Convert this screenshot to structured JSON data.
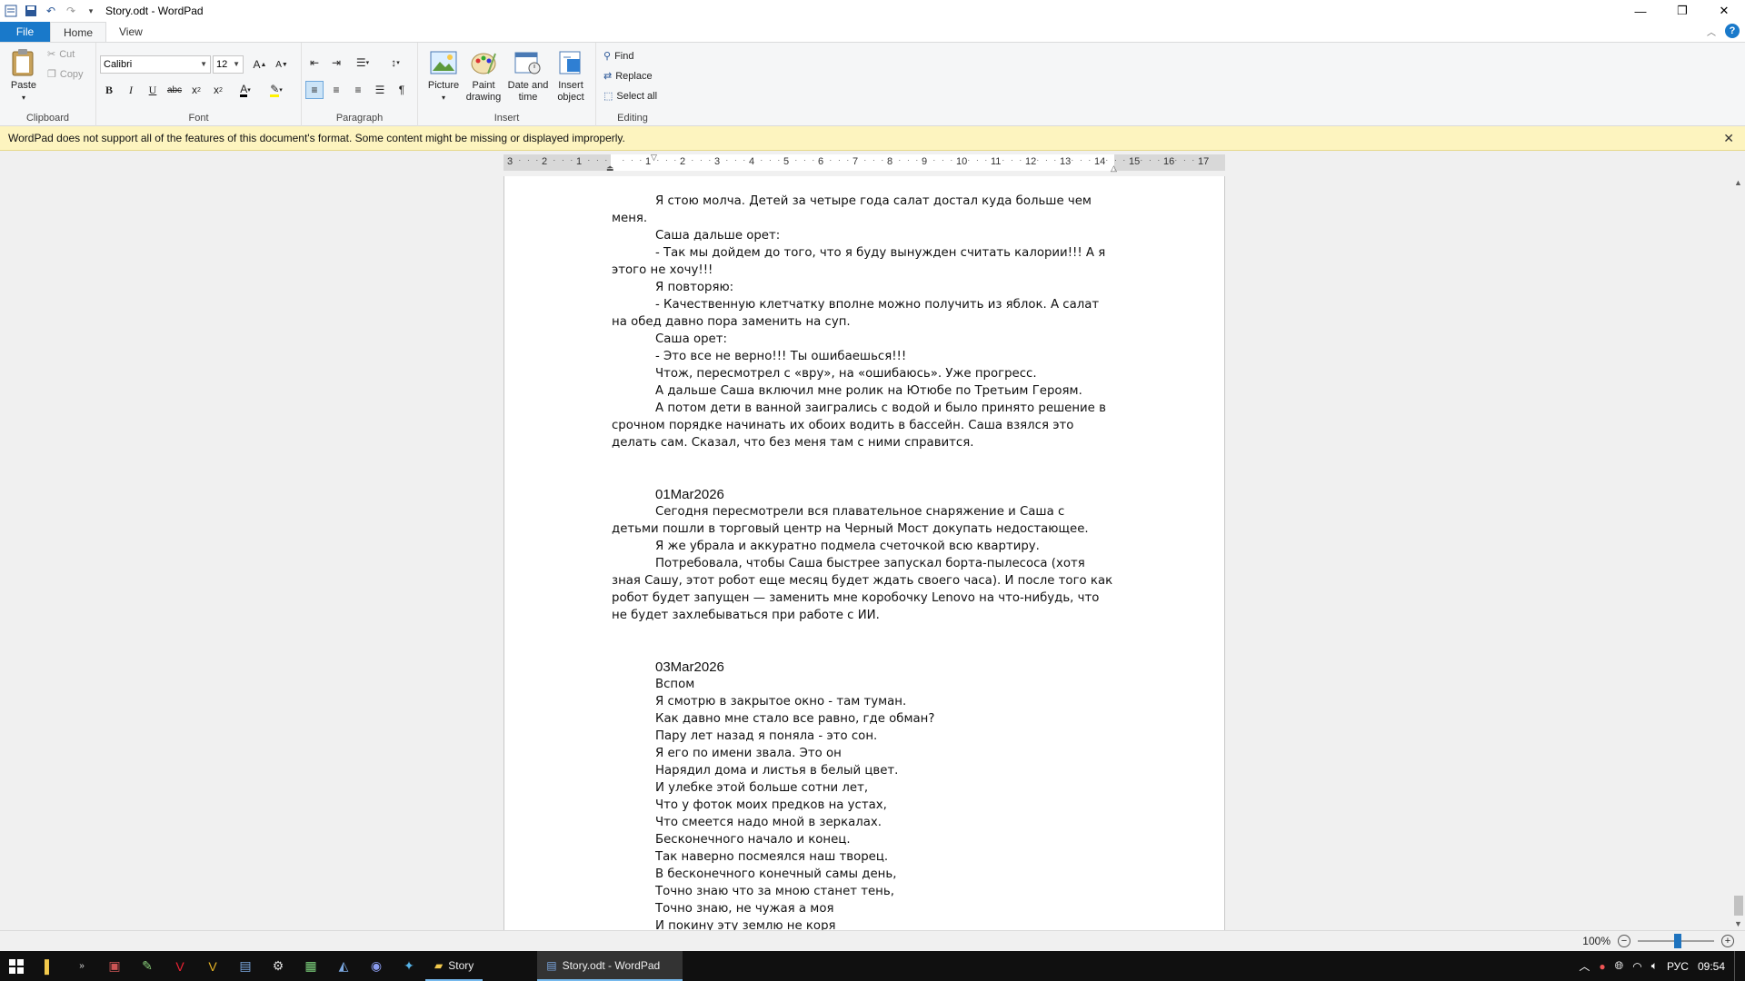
{
  "window": {
    "title": "Story.odt - WordPad",
    "controls": {
      "minimize": "—",
      "maximize": "❐",
      "close": "✕"
    }
  },
  "ribbon": {
    "tabs": [
      "File",
      "Home",
      "View"
    ],
    "clipboard": {
      "label": "Clipboard",
      "paste": "Paste",
      "cut": "Cut",
      "copy": "Copy"
    },
    "font": {
      "label": "Font",
      "family": "Calibri",
      "size": "12"
    },
    "paragraph": {
      "label": "Paragraph"
    },
    "insert": {
      "label": "Insert",
      "picture": "Picture",
      "paint_drawing": "Paint drawing",
      "date_time": "Date and time",
      "insert_object": "Insert object"
    },
    "editing": {
      "label": "Editing",
      "find": "Find",
      "replace": "Replace",
      "select_all": "Select all"
    }
  },
  "infobar": {
    "message": "WordPad does not support all of the features of this document's format. Some content might be missing or displayed improperly."
  },
  "ruler": {
    "numbers": [
      "3",
      "2",
      "1",
      "",
      "1",
      "2",
      "3",
      "4",
      "5",
      "6",
      "7",
      "8",
      "9",
      "10",
      "11",
      "12",
      "13",
      "14",
      "15",
      "16",
      "17"
    ]
  },
  "document": {
    "lines": [
      {
        "type": "ind",
        "text": "Я стою молча. Детей за четыре года салат достал куда больше чем меня."
      },
      {
        "type": "ind",
        "text": "Саша дальше орет:"
      },
      {
        "type": "ind",
        "text": "- Так мы дойдем до того, что я буду вынужден считать калории!!! А я этого не хочу!!!"
      },
      {
        "type": "ind",
        "text": "Я повторяю:"
      },
      {
        "type": "ind",
        "text": "- Качественную клетчатку вполне можно получить из яблок. А салат на обед давно пора  заменить на суп."
      },
      {
        "type": "ind",
        "text": "Саша орет:"
      },
      {
        "type": "ind",
        "text": "- Это все не верно!!! Ты ошибаешься!!!"
      },
      {
        "type": "ind",
        "text": "Чтож,  пересмотрел  с «вру», на «ошибаюсь». Уже прогресс."
      },
      {
        "type": "ind",
        "text": "А дальше Саша включил мне ролик на Ютюбе по Третьим Героям."
      },
      {
        "type": "ind",
        "text": "А потом дети в ванной заигрались с водой и было принято решение в срочном порядке начинать их обоих водить в бассейн. Саша взялся это делать сам. Сказал, что без меня там с ними справится."
      },
      {
        "type": "gap",
        "text": ""
      },
      {
        "type": "gap",
        "text": ""
      },
      {
        "type": "date",
        "text": "01Mar2026"
      },
      {
        "type": "ind",
        "text": "Сегодня пересмотрели вся плавательное снаряжение и Саша с детьми пошли в торговый центр на Черный Мост докупать недостающее."
      },
      {
        "type": "ind",
        "text": "Я же убрала и аккуратно подмела счеточкой всю квартиру."
      },
      {
        "type": "ind",
        "text": "Потребовала, чтобы Саша быстрее запускал борта-пылесоса (хотя зная Сашу, этот робот еще месяц будет ждать своего часа). И после того как робот будет запущен — заменить мне коробочку Lenovo  на что-нибудь, что не будет захлебываться при работе с ИИ."
      },
      {
        "type": "gap",
        "text": ""
      },
      {
        "type": "gap",
        "text": ""
      },
      {
        "type": "date",
        "text": "03Mar2026"
      },
      {
        "type": "poem",
        "text": "Вспом"
      },
      {
        "type": "poem",
        "text": "Я смотрю в закрытое окно - там туман."
      },
      {
        "type": "poem",
        "text": "Как давно мне стало все равно, где обман?"
      },
      {
        "type": "poem",
        "text": "Пару лет назад я поняла - это сон."
      },
      {
        "type": "poem",
        "text": "Я его по имени звала. Это он"
      },
      {
        "type": "poem",
        "text": "Нарядил дома и листья в белый цвет."
      },
      {
        "type": "poem",
        "text": "И улебке этой больше сотни лет,"
      },
      {
        "type": "poem",
        "text": "Что у фоток моих предков на устах,"
      },
      {
        "type": "poem",
        "text": "Что смеется надо мной в зеркалах."
      },
      {
        "type": "poem",
        "text": "Бесконечного начало и конец."
      },
      {
        "type": "poem",
        "text": "Так наверно посмеялся наш творец."
      },
      {
        "type": "poem",
        "text": "В бесконечного конечный самы день,"
      },
      {
        "type": "poem",
        "text": "Точно знаю что за мною станет тень,"
      },
      {
        "type": "poem",
        "text": "Точно знаю, не чужая а моя"
      },
      {
        "type": "poem",
        "text": "И покину эту землю не коря"
      }
    ]
  },
  "statusbar": {
    "zoom": "100%",
    "zoom_level_percent": 100
  },
  "taskbar": {
    "tasks": [
      {
        "label": "Story"
      },
      {
        "label": "Story.odt - WordPad"
      }
    ],
    "tray": {
      "lang": "РУС",
      "time": "09:54"
    }
  }
}
